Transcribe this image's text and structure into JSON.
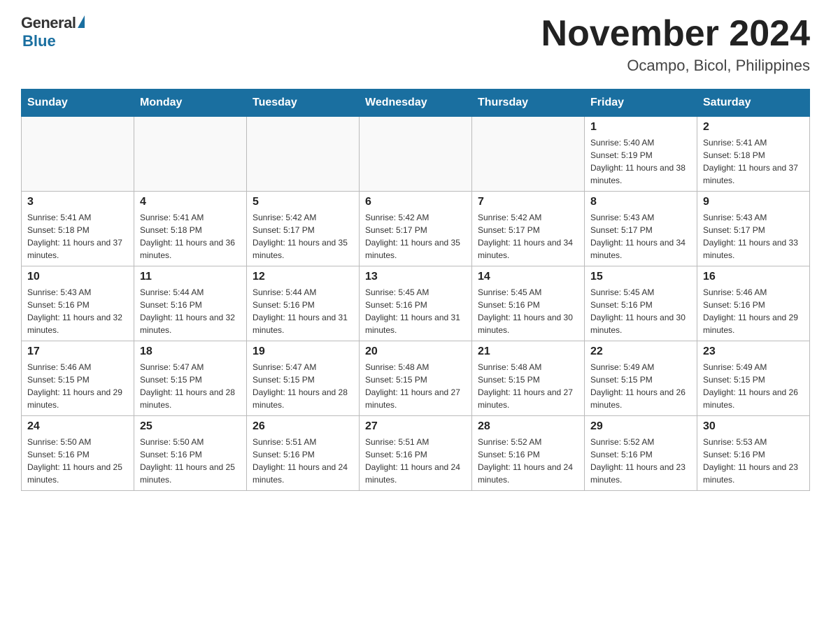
{
  "logo": {
    "general": "General",
    "blue": "Blue"
  },
  "title": {
    "month_year": "November 2024",
    "location": "Ocampo, Bicol, Philippines"
  },
  "weekdays": [
    "Sunday",
    "Monday",
    "Tuesday",
    "Wednesday",
    "Thursday",
    "Friday",
    "Saturday"
  ],
  "weeks": [
    [
      {
        "day": "",
        "info": ""
      },
      {
        "day": "",
        "info": ""
      },
      {
        "day": "",
        "info": ""
      },
      {
        "day": "",
        "info": ""
      },
      {
        "day": "",
        "info": ""
      },
      {
        "day": "1",
        "info": "Sunrise: 5:40 AM\nSunset: 5:19 PM\nDaylight: 11 hours and 38 minutes."
      },
      {
        "day": "2",
        "info": "Sunrise: 5:41 AM\nSunset: 5:18 PM\nDaylight: 11 hours and 37 minutes."
      }
    ],
    [
      {
        "day": "3",
        "info": "Sunrise: 5:41 AM\nSunset: 5:18 PM\nDaylight: 11 hours and 37 minutes."
      },
      {
        "day": "4",
        "info": "Sunrise: 5:41 AM\nSunset: 5:18 PM\nDaylight: 11 hours and 36 minutes."
      },
      {
        "day": "5",
        "info": "Sunrise: 5:42 AM\nSunset: 5:17 PM\nDaylight: 11 hours and 35 minutes."
      },
      {
        "day": "6",
        "info": "Sunrise: 5:42 AM\nSunset: 5:17 PM\nDaylight: 11 hours and 35 minutes."
      },
      {
        "day": "7",
        "info": "Sunrise: 5:42 AM\nSunset: 5:17 PM\nDaylight: 11 hours and 34 minutes."
      },
      {
        "day": "8",
        "info": "Sunrise: 5:43 AM\nSunset: 5:17 PM\nDaylight: 11 hours and 34 minutes."
      },
      {
        "day": "9",
        "info": "Sunrise: 5:43 AM\nSunset: 5:17 PM\nDaylight: 11 hours and 33 minutes."
      }
    ],
    [
      {
        "day": "10",
        "info": "Sunrise: 5:43 AM\nSunset: 5:16 PM\nDaylight: 11 hours and 32 minutes."
      },
      {
        "day": "11",
        "info": "Sunrise: 5:44 AM\nSunset: 5:16 PM\nDaylight: 11 hours and 32 minutes."
      },
      {
        "day": "12",
        "info": "Sunrise: 5:44 AM\nSunset: 5:16 PM\nDaylight: 11 hours and 31 minutes."
      },
      {
        "day": "13",
        "info": "Sunrise: 5:45 AM\nSunset: 5:16 PM\nDaylight: 11 hours and 31 minutes."
      },
      {
        "day": "14",
        "info": "Sunrise: 5:45 AM\nSunset: 5:16 PM\nDaylight: 11 hours and 30 minutes."
      },
      {
        "day": "15",
        "info": "Sunrise: 5:45 AM\nSunset: 5:16 PM\nDaylight: 11 hours and 30 minutes."
      },
      {
        "day": "16",
        "info": "Sunrise: 5:46 AM\nSunset: 5:16 PM\nDaylight: 11 hours and 29 minutes."
      }
    ],
    [
      {
        "day": "17",
        "info": "Sunrise: 5:46 AM\nSunset: 5:15 PM\nDaylight: 11 hours and 29 minutes."
      },
      {
        "day": "18",
        "info": "Sunrise: 5:47 AM\nSunset: 5:15 PM\nDaylight: 11 hours and 28 minutes."
      },
      {
        "day": "19",
        "info": "Sunrise: 5:47 AM\nSunset: 5:15 PM\nDaylight: 11 hours and 28 minutes."
      },
      {
        "day": "20",
        "info": "Sunrise: 5:48 AM\nSunset: 5:15 PM\nDaylight: 11 hours and 27 minutes."
      },
      {
        "day": "21",
        "info": "Sunrise: 5:48 AM\nSunset: 5:15 PM\nDaylight: 11 hours and 27 minutes."
      },
      {
        "day": "22",
        "info": "Sunrise: 5:49 AM\nSunset: 5:15 PM\nDaylight: 11 hours and 26 minutes."
      },
      {
        "day": "23",
        "info": "Sunrise: 5:49 AM\nSunset: 5:15 PM\nDaylight: 11 hours and 26 minutes."
      }
    ],
    [
      {
        "day": "24",
        "info": "Sunrise: 5:50 AM\nSunset: 5:16 PM\nDaylight: 11 hours and 25 minutes."
      },
      {
        "day": "25",
        "info": "Sunrise: 5:50 AM\nSunset: 5:16 PM\nDaylight: 11 hours and 25 minutes."
      },
      {
        "day": "26",
        "info": "Sunrise: 5:51 AM\nSunset: 5:16 PM\nDaylight: 11 hours and 24 minutes."
      },
      {
        "day": "27",
        "info": "Sunrise: 5:51 AM\nSunset: 5:16 PM\nDaylight: 11 hours and 24 minutes."
      },
      {
        "day": "28",
        "info": "Sunrise: 5:52 AM\nSunset: 5:16 PM\nDaylight: 11 hours and 24 minutes."
      },
      {
        "day": "29",
        "info": "Sunrise: 5:52 AM\nSunset: 5:16 PM\nDaylight: 11 hours and 23 minutes."
      },
      {
        "day": "30",
        "info": "Sunrise: 5:53 AM\nSunset: 5:16 PM\nDaylight: 11 hours and 23 minutes."
      }
    ]
  ]
}
